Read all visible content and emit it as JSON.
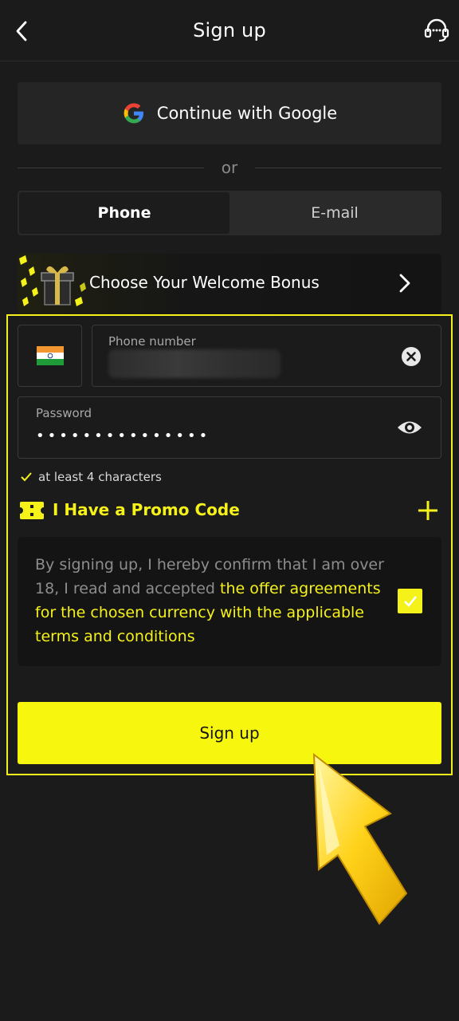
{
  "header": {
    "title": "Sign up",
    "back_icon": "chevron-left-icon",
    "support_icon": "headset-icon"
  },
  "google": {
    "label": "Continue with Google",
    "icon": "google-icon"
  },
  "divider": {
    "text": "or"
  },
  "tabs": [
    {
      "label": "Phone",
      "active": true
    },
    {
      "label": "E-mail",
      "active": false
    }
  ],
  "bonus": {
    "label": "Choose Your Welcome Bonus",
    "icon": "gift-icon"
  },
  "form": {
    "country_flag": "india-flag-icon",
    "phone": {
      "label": "Phone number"
    },
    "password": {
      "label": "Password",
      "value": "•••••••••••••••"
    },
    "hint": "at least 4 characters",
    "promo_label": "I Have a Promo Code"
  },
  "terms": {
    "plain": "By signing up, I hereby confirm that I am over 18, I read and accepted ",
    "link": "the offer agreements for the chosen currency with the applicable terms and conditions",
    "checked": true
  },
  "submit": {
    "label": "Sign up"
  },
  "colors": {
    "accent": "#f5f21a",
    "background": "#1b1b1b",
    "button": "#f7f60f"
  }
}
